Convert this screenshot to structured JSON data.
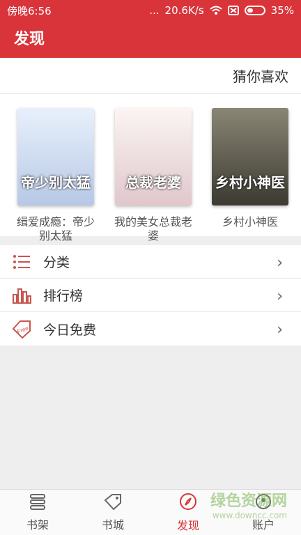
{
  "status_bar": {
    "time": "傍晚6:56",
    "network_speed": "20.6K/s",
    "battery": "35%",
    "dots": "..."
  },
  "header": {
    "title": "发现"
  },
  "guess": {
    "title": "猜你喜欢",
    "books": [
      {
        "title": "缉爱成瘾：帝少别太猛",
        "cover_color": "#d8e4f4",
        "cover_text": "帝少别太猛"
      },
      {
        "title": "我的美女总裁老婆",
        "cover_color": "#f3e7e9",
        "cover_text": "总裁老婆"
      },
      {
        "title": "乡村小神医",
        "cover_color": "#6b6a5a",
        "cover_text": "乡村小神医"
      }
    ]
  },
  "menu": {
    "items": [
      {
        "label": "分类",
        "icon": "list-icon"
      },
      {
        "label": "排行榜",
        "icon": "chart-icon"
      },
      {
        "label": "今日免费",
        "icon": "free-tag-icon"
      }
    ]
  },
  "bottom_nav": {
    "items": [
      {
        "label": "书架",
        "icon": "bookshelf-icon"
      },
      {
        "label": "书城",
        "icon": "store-tag-icon"
      },
      {
        "label": "发现",
        "icon": "compass-icon",
        "active": true
      },
      {
        "label": "账户",
        "icon": "account-icon"
      }
    ]
  },
  "watermark": {
    "line1": "绿色资源网",
    "line2": "www.downcc.com"
  },
  "colors": {
    "accent": "#d9343a",
    "menu_icon": "#c9554f"
  }
}
